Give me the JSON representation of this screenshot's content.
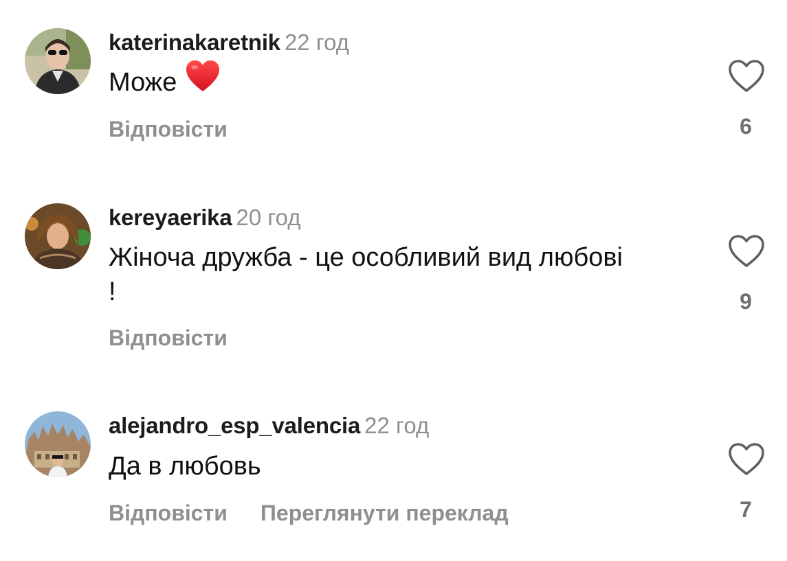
{
  "comments": [
    {
      "username": "katerinakaretnik",
      "time": "22 год",
      "text": "Може",
      "reply_label": "Відповісти",
      "likes": "6",
      "avatar_icon": "user-avatar-icon"
    },
    {
      "username": "kereyaerika",
      "time": "20 год",
      "text": "Жіноча дружба - це особливий вид любові !",
      "reply_label": "Відповісти",
      "likes": "9",
      "avatar_icon": "user-avatar-icon"
    },
    {
      "username": "alejandro_esp_valencia",
      "time": "22 год",
      "text": "Да в любовь",
      "reply_label": "Відповісти",
      "translate_label": "Переглянути переклад",
      "likes": "7",
      "avatar_icon": "user-avatar-icon"
    }
  ],
  "icons": {
    "like": "heart-outline-icon",
    "emoji": "red-heart-emoji-icon"
  },
  "colors": {
    "secondary_text": "#8e8e93",
    "emoji_heart": "#e8192c"
  }
}
